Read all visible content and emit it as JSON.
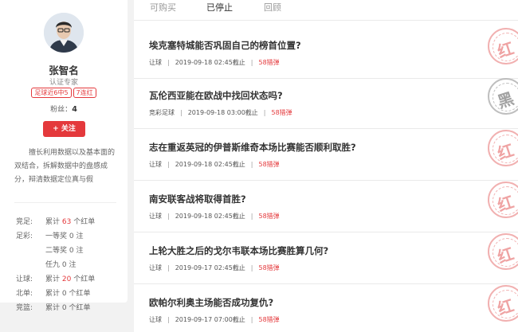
{
  "profile": {
    "name": "张智名",
    "level": "认证专家",
    "badges": [
      "足球近6中5",
      "7连红"
    ],
    "fans_label": "粉丝：",
    "fans_count": "4",
    "follow_label": "+ 关注",
    "bio": "擅长利用数据以及基本面的双结合，拆解数据中的盘感成分，辩清数据定位真与假"
  },
  "stats": [
    {
      "label": "竞足:",
      "pre": "累计",
      "num": "63",
      "post": "个红单",
      "highlight": true
    },
    {
      "label": "足彩:",
      "pre": "一等奖",
      "num": "0",
      "post": "注",
      "highlight": false
    },
    {
      "label": "",
      "pre": "二等奖",
      "num": "0",
      "post": "注",
      "highlight": false
    },
    {
      "label": "",
      "pre": "任九",
      "num": "0",
      "post": "注",
      "highlight": false
    },
    {
      "label": "让球:",
      "pre": "累计",
      "num": "20",
      "post": "个红单",
      "highlight": true
    },
    {
      "label": "北单:",
      "pre": "累计",
      "num": "0",
      "post": "个红单",
      "highlight": false
    },
    {
      "label": "竞篮:",
      "pre": "累计",
      "num": "0",
      "post": "个红单",
      "highlight": false
    }
  ],
  "tabs": [
    "可购买",
    "已停止",
    "回顾"
  ],
  "active_tab": 1,
  "items": [
    {
      "title": "埃克塞特城能否巩固自己的榜首位置?",
      "type": "让球",
      "time": "2019-09-18 02:45截止",
      "price": "58猎弹",
      "stamp": "红",
      "stamp_color": "red"
    },
    {
      "title": "瓦伦西亚能在欧战中找回状态吗?",
      "type": "竞彩足球",
      "time": "2019-09-18 03:00截止",
      "price": "58猎弹",
      "stamp": "黑",
      "stamp_color": "black"
    },
    {
      "title": "志在重返英冠的伊普斯维奇本场比赛能否顺利取胜?",
      "type": "让球",
      "time": "2019-09-18 02:45截止",
      "price": "58猎弹",
      "stamp": "红",
      "stamp_color": "red"
    },
    {
      "title": "南安联客战将取得首胜?",
      "type": "让球",
      "time": "2019-09-18 02:45截止",
      "price": "58猎弹",
      "stamp": "红",
      "stamp_color": "red"
    },
    {
      "title": "上轮大胜之后的戈尔韦联本场比赛胜算几何?",
      "type": "让球",
      "time": "2019-09-17 02:45截止",
      "price": "58猎弹",
      "stamp": "红",
      "stamp_color": "red"
    },
    {
      "title": "欧帕尔利奥主场能否成功复仇?",
      "type": "让球",
      "time": "2019-09-17 07:00截止",
      "price": "58猎弹",
      "stamp": "红",
      "stamp_color": "red"
    }
  ],
  "colors": {
    "accent": "#e4393c",
    "stamp_red": "#ee9a9a",
    "stamp_black": "#999999"
  }
}
